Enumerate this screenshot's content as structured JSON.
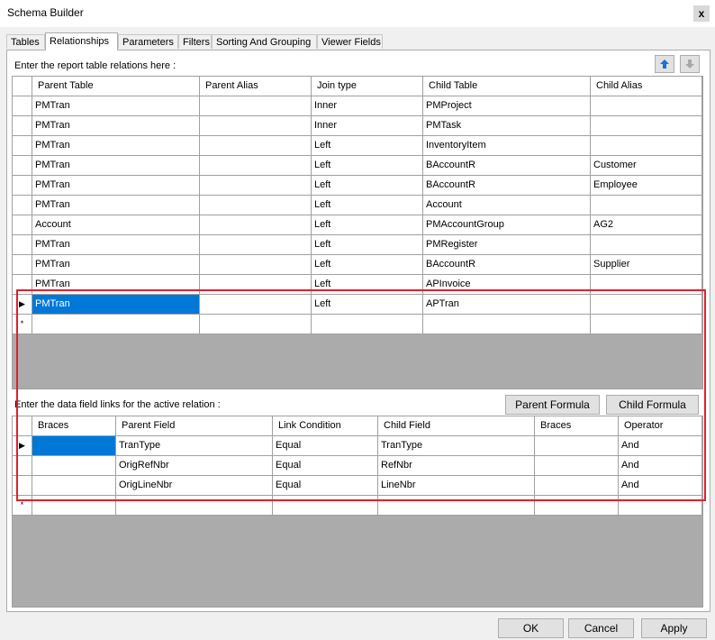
{
  "window": {
    "title": "Schema Builder",
    "close_glyph": "x"
  },
  "tabs": [
    "Tables",
    "Relationships",
    "Parameters",
    "Filters",
    "Sorting And Grouping",
    "Viewer Fields"
  ],
  "active_tab": "Relationships",
  "relations": {
    "label": "Enter the report table relations here :",
    "headers": [
      "Parent Table",
      "Parent Alias",
      "Join type",
      "Child Table",
      "Child Alias"
    ],
    "rows": [
      [
        "PMTran",
        "",
        "Inner",
        "PMProject",
        ""
      ],
      [
        "PMTran",
        "",
        "Inner",
        "PMTask",
        ""
      ],
      [
        "PMTran",
        "",
        "Left",
        "InventoryItem",
        ""
      ],
      [
        "PMTran",
        "",
        "Left",
        "BAccountR",
        "Customer"
      ],
      [
        "PMTran",
        "",
        "Left",
        "BAccountR",
        "Employee"
      ],
      [
        "PMTran",
        "",
        "Left",
        "Account",
        ""
      ],
      [
        "Account",
        "",
        "Left",
        "PMAccountGroup",
        "AG2"
      ],
      [
        "PMTran",
        "",
        "Left",
        "PMRegister",
        ""
      ],
      [
        "PMTran",
        "",
        "Left",
        "BAccountR",
        "Supplier"
      ],
      [
        "PMTran",
        "",
        "Left",
        "APInvoice",
        ""
      ],
      [
        "PMTran",
        "",
        "Left",
        "APTran",
        ""
      ]
    ],
    "active_row": 10,
    "move_up_icon": "arrow-up-icon",
    "move_down_icon": "arrow-down-icon"
  },
  "links": {
    "label": "Enter the data field links for the active relation :",
    "parent_formula_label": "Parent Formula",
    "child_formula_label": "Child Formula",
    "headers": [
      "Braces",
      "Parent Field",
      "Link Condition",
      "Child Field",
      "Braces",
      "Operator"
    ],
    "rows": [
      [
        "",
        "TranType",
        "Equal",
        "TranType",
        "",
        "And"
      ],
      [
        "",
        "OrigRefNbr",
        "Equal",
        "RefNbr",
        "",
        "And"
      ],
      [
        "",
        "OrigLineNbr",
        "Equal",
        "LineNbr",
        "",
        "And"
      ]
    ],
    "active_row": 0
  },
  "footer": {
    "ok_label": "OK",
    "cancel_label": "Cancel",
    "apply_label": "Apply"
  },
  "markers": {
    "current_row": "▶",
    "new_row": "*"
  },
  "colors": {
    "selection": "#0078d7",
    "highlight_box": "#e0202c",
    "grid_empty": "#ababab"
  }
}
